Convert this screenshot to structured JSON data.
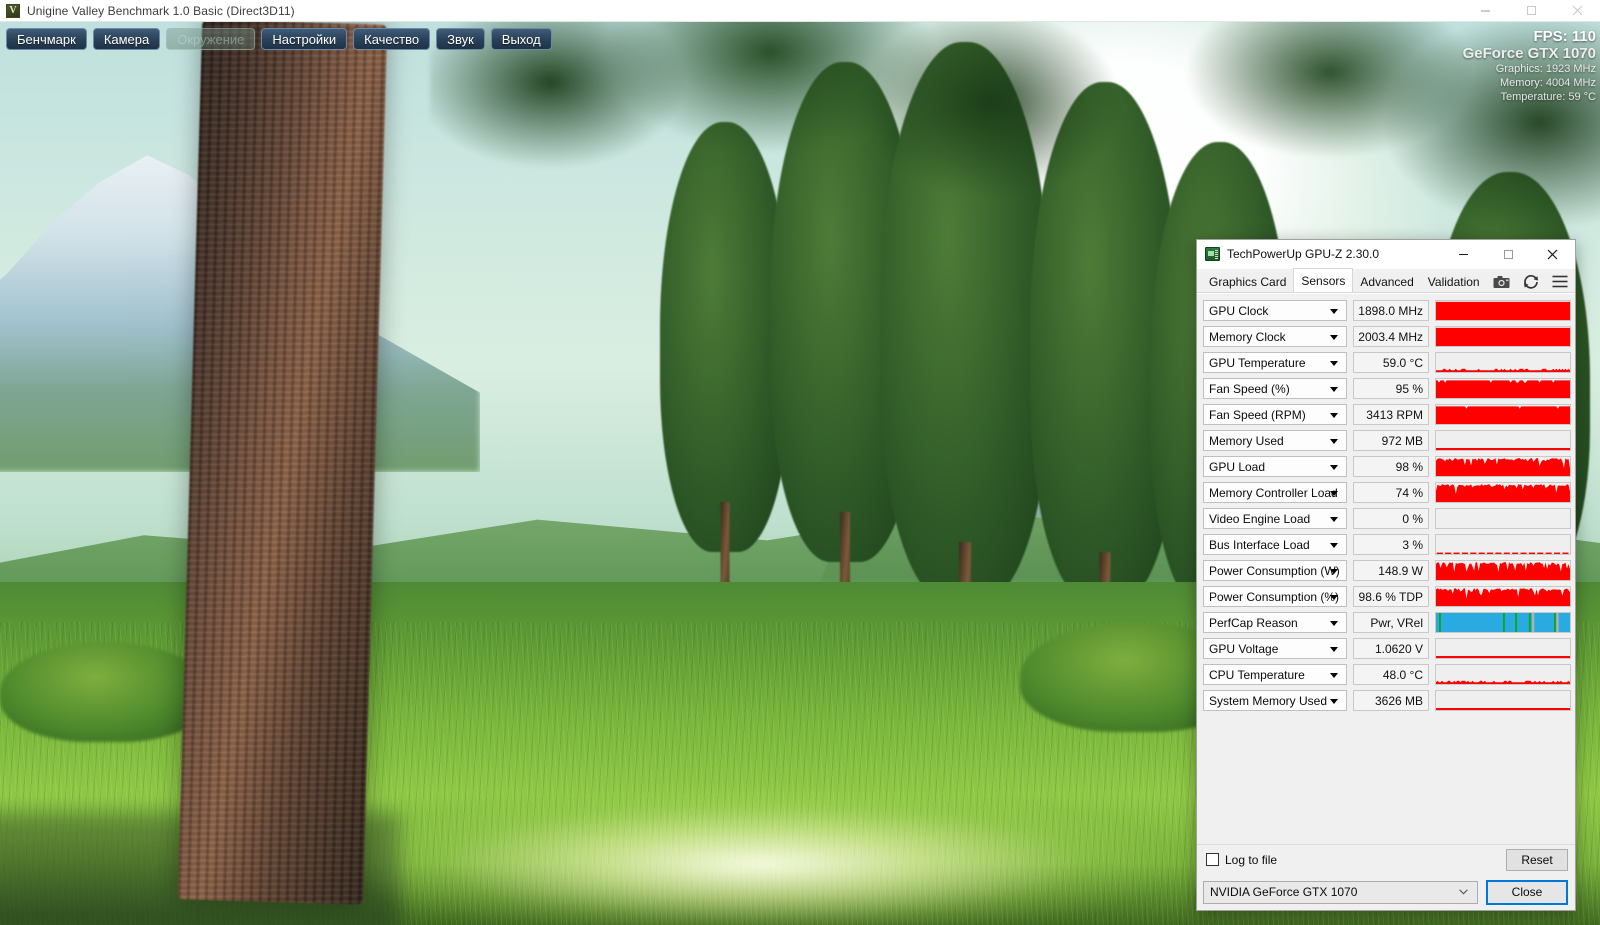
{
  "unigine": {
    "titlebar": {
      "title": "Unigine Valley Benchmark 1.0 Basic (Direct3D11)",
      "icon": "unigine-valley-icon",
      "minimize": "–",
      "maximize": "□",
      "close": "×"
    },
    "menu_buttons": [
      {
        "label": "Бенчмарк",
        "name": "benchmark",
        "disabled": false
      },
      {
        "label": "Камера",
        "name": "camera",
        "disabled": false
      },
      {
        "label": "Окружение",
        "name": "environment",
        "disabled": true
      },
      {
        "label": "Настройки",
        "name": "settings",
        "disabled": false
      },
      {
        "label": "Качество",
        "name": "quality",
        "disabled": false
      },
      {
        "label": "Звук",
        "name": "sound",
        "disabled": false
      },
      {
        "label": "Выход",
        "name": "exit",
        "disabled": false
      }
    ],
    "overlay": {
      "fps": "FPS: 110",
      "gpu": "GeForce GTX 1070",
      "graphics": "Graphics: 1923 MHz",
      "memory": "Memory: 4004 MHz",
      "temperature": "Temperature: 59 °C"
    }
  },
  "gpuz": {
    "titlebar": {
      "title": "TechPowerUp GPU-Z 2.30.0",
      "icon": "gpu-z-icon",
      "minimize": "—",
      "maximize": "□",
      "close": "✕"
    },
    "tabs": [
      {
        "label": "Graphics Card",
        "active": false
      },
      {
        "label": "Sensors",
        "active": true
      },
      {
        "label": "Advanced",
        "active": false
      },
      {
        "label": "Validation",
        "active": false
      }
    ],
    "tools": [
      {
        "name": "camera-icon",
        "glyph": "📷"
      },
      {
        "name": "refresh-icon",
        "glyph": "↻"
      },
      {
        "name": "menu-icon",
        "glyph": "☰"
      }
    ],
    "sensors": [
      {
        "name": "GPU Clock",
        "value": "1898.0 MHz",
        "graph": "full",
        "color": "#ff0000"
      },
      {
        "name": "Memory Clock",
        "value": "2003.4 MHz",
        "graph": "full",
        "color": "#ff0000"
      },
      {
        "name": "GPU Temperature",
        "value": "59.0 °C",
        "graph": "lowflat",
        "color": "#ff0000"
      },
      {
        "name": "Fan Speed (%)",
        "value": "95 %",
        "graph": "highflat",
        "color": "#ff0000"
      },
      {
        "name": "Fan Speed (RPM)",
        "value": "3413 RPM",
        "graph": "highflat",
        "color": "#ff0000"
      },
      {
        "name": "Memory Used",
        "value": "972 MB",
        "graph": "baseline",
        "color": "#ff0000"
      },
      {
        "name": "GPU Load",
        "value": "98 %",
        "graph": "noisy",
        "color": "#ff0000"
      },
      {
        "name": "Memory Controller Load",
        "value": "74 %",
        "graph": "noisy",
        "color": "#ff0000"
      },
      {
        "name": "Video Engine Load",
        "value": "0 %",
        "graph": "empty",
        "color": "#ff0000"
      },
      {
        "name": "Bus Interface Load",
        "value": "3 %",
        "graph": "dashed",
        "color": "#ff0000"
      },
      {
        "name": "Power Consumption (W)",
        "value": "148.9 W",
        "graph": "noisy",
        "color": "#ff0000"
      },
      {
        "name": "Power Consumption (%)",
        "value": "98.6 % TDP",
        "graph": "noisy",
        "color": "#ff0000"
      },
      {
        "name": "PerfCap Reason",
        "value": "Pwr, VRel",
        "graph": "perfcap",
        "color": "#29abe2"
      },
      {
        "name": "GPU Voltage",
        "value": "1.0620 V",
        "graph": "baseline",
        "color": "#ff0000"
      },
      {
        "name": "CPU Temperature",
        "value": "48.0 °C",
        "graph": "lowflat",
        "color": "#ff0000"
      },
      {
        "name": "System Memory Used",
        "value": "3626 MB",
        "graph": "baseline",
        "color": "#ff0000"
      }
    ],
    "footer": {
      "log_to_file_label": "Log to file",
      "log_to_file_checked": false,
      "reset_label": "Reset"
    },
    "bottom": {
      "gpu_selected": "NVIDIA GeForce GTX 1070",
      "close_label": "Close"
    },
    "colors": {
      "graph_red": "#ff0000",
      "perfcap_blue": "#29abe2",
      "perfcap_green": "#13a413",
      "perfcap_gray": "#b0b0b0",
      "accent_focus": "#0078d7"
    }
  }
}
